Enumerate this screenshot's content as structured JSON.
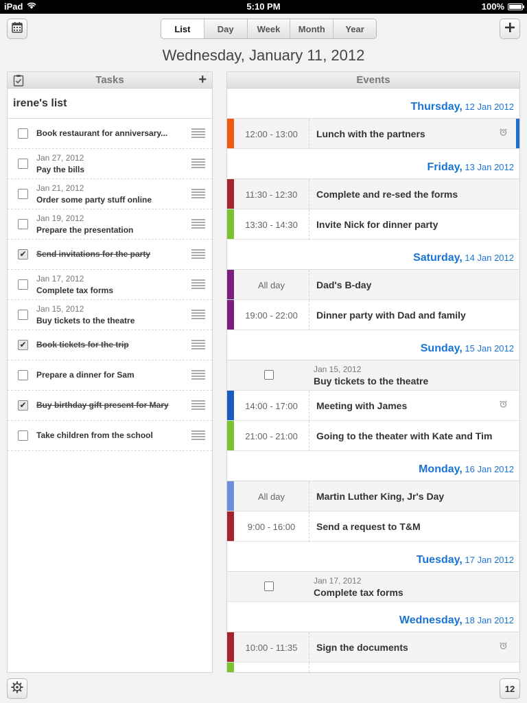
{
  "statusbar": {
    "device": "iPad",
    "time": "5:10 PM",
    "battery": "100%"
  },
  "toolbar": {
    "views": [
      "List",
      "Day",
      "Week",
      "Month",
      "Year"
    ],
    "active_view": "List",
    "date_title": "Wednesday, January 11, 2012",
    "today_number": "12"
  },
  "tasks": {
    "header": "Tasks",
    "list_name": "irene's list",
    "items": [
      {
        "date": "",
        "title": "Book restaurant for anniversary...",
        "done": false
      },
      {
        "date": "Jan 27, 2012",
        "title": "Pay the bills",
        "done": false
      },
      {
        "date": "Jan 21, 2012",
        "title": "Order some party stuff online",
        "done": false
      },
      {
        "date": "Jan 19, 2012",
        "title": "Prepare the presentation",
        "done": false
      },
      {
        "date": "",
        "title": "Send invitations for the party",
        "done": true
      },
      {
        "date": "Jan 17, 2012",
        "title": "Complete tax forms",
        "done": false
      },
      {
        "date": "Jan 15, 2012",
        "title": "Buy tickets to the theatre",
        "done": false
      },
      {
        "date": "",
        "title": "Book tickets for the trip",
        "done": true
      },
      {
        "date": "",
        "title": "Prepare a dinner for Sam",
        "done": false
      },
      {
        "date": "",
        "title": "Buy birthday gift  present for Mary",
        "done": true
      },
      {
        "date": "",
        "title": "Take children from the school",
        "done": false
      }
    ]
  },
  "events": {
    "header": "Events",
    "days": [
      {
        "name": "Thursday,",
        "date": "12 Jan 2012",
        "items": [
          {
            "kind": "event",
            "time": "12:00 - 13:00",
            "title": "Lunch with the partners",
            "color": "#f05a14",
            "alarm": true,
            "right_color": "#1a6fd0",
            "shaded": true
          }
        ]
      },
      {
        "name": "Friday,",
        "date": "13 Jan 2012",
        "items": [
          {
            "kind": "event",
            "time": "11:30 - 12:30",
            "title": "Complete and re-sed the forms",
            "color": "#a8232a",
            "alarm": false,
            "shaded": true
          },
          {
            "kind": "event",
            "time": "13:30 - 14:30",
            "title": "Invite Nick  for dinner party",
            "color": "#7ac231",
            "alarm": false,
            "shaded": false
          }
        ]
      },
      {
        "name": "Saturday,",
        "date": "14 Jan 2012",
        "items": [
          {
            "kind": "event",
            "time": "All day",
            "title": "Dad's B-day",
            "color": "#7b1f7e",
            "alarm": false,
            "shaded": true
          },
          {
            "kind": "event",
            "time": "19:00 - 22:00",
            "title": "Dinner party with Dad and family",
            "color": "#7b1f7e",
            "alarm": false,
            "shaded": false
          }
        ]
      },
      {
        "name": "Sunday,",
        "date": "15 Jan 2012",
        "items": [
          {
            "kind": "task",
            "date": "Jan 15, 2012",
            "title": "Buy tickets to the theatre"
          },
          {
            "kind": "event",
            "time": "14:00 - 17:00",
            "title": "Meeting with James",
            "color": "#1a5bbf",
            "alarm": true,
            "shaded": false
          },
          {
            "kind": "event",
            "time": "21:00 - 21:00",
            "title": "Going to the theater with Kate and Tim",
            "color": "#7ac231",
            "alarm": false,
            "shaded": false
          }
        ]
      },
      {
        "name": "Monday,",
        "date": "16 Jan 2012",
        "items": [
          {
            "kind": "event",
            "time": "All day",
            "title": "Martin Luther King, Jr's Day",
            "color": "#6a8fdc",
            "alarm": false,
            "shaded": true
          },
          {
            "kind": "event",
            "time": "9:00 - 16:00",
            "title": "Send a request to T&M",
            "color": "#a8232a",
            "alarm": false,
            "shaded": false
          }
        ]
      },
      {
        "name": "Tuesday,",
        "date": "17 Jan 2012",
        "items": [
          {
            "kind": "task",
            "date": "Jan 17, 2012",
            "title": "Complete tax forms"
          }
        ]
      },
      {
        "name": "Wednesday,",
        "date": "18 Jan 2012",
        "items": [
          {
            "kind": "event",
            "time": "10:00 - 11:35",
            "title": "Sign the documents",
            "color": "#a8232a",
            "alarm": true,
            "shaded": true
          },
          {
            "kind": "event",
            "time": "",
            "title": "",
            "color": "#7ac231",
            "alarm": false,
            "shaded": false
          }
        ]
      }
    ]
  }
}
